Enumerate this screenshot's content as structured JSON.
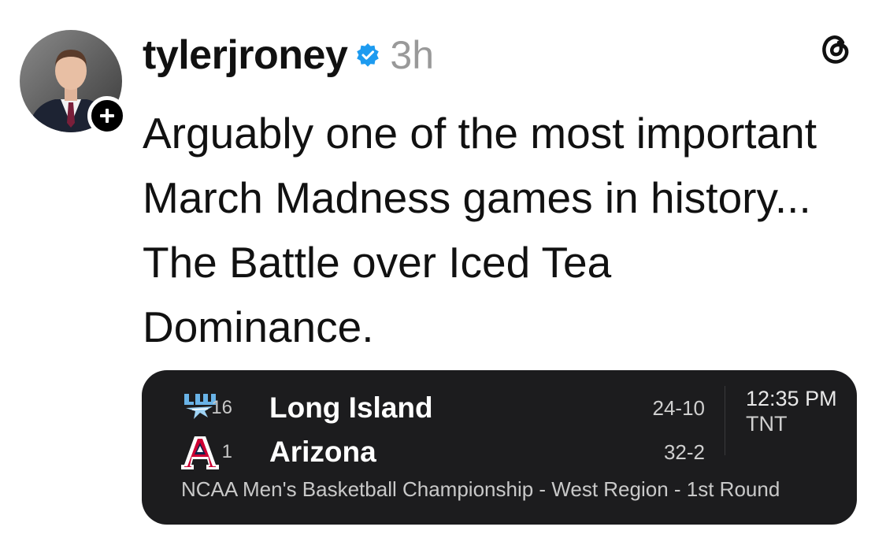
{
  "post": {
    "username": "tylerjroney",
    "timestamp": "3h",
    "text": "Arguably one of the most important March Madness games in history... The Battle over Iced Tea Dominance."
  },
  "icons": {
    "verified": "verified-badge-icon",
    "follow": "plus-icon",
    "app": "threads-logo-icon"
  },
  "colors": {
    "verified": "#1d9bf0",
    "card_bg": "#1c1c1e",
    "timestamp": "#999999"
  },
  "game": {
    "teams": [
      {
        "seed": "16",
        "name": "Long Island",
        "record": "24-10",
        "logo_color": "#69b3e7"
      },
      {
        "seed": "1",
        "name": "Arizona",
        "record": "32-2",
        "logo_color": "#cc0033"
      }
    ],
    "time": "12:35 PM",
    "network": "TNT",
    "event": "NCAA Men's Basketball Championship - West Region - 1st Round"
  }
}
